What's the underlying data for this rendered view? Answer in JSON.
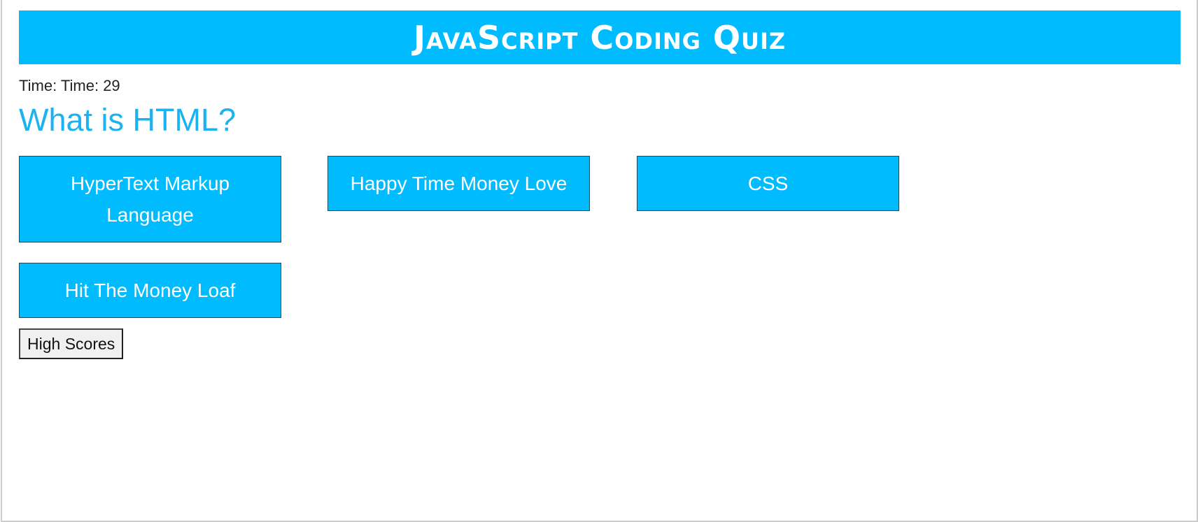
{
  "header": {
    "title": "JavaScript Coding Quiz"
  },
  "timer": {
    "text": "Time: Time: 29"
  },
  "question": {
    "text": "What is HTML?",
    "choices": [
      "HyperText Markup Language",
      "Happy Time Money Love",
      "CSS",
      "Hit The Money Loaf"
    ]
  },
  "controls": {
    "high_scores_label": "High Scores"
  },
  "colors": {
    "accent": "#00bcff",
    "question_text": "#1ab2f0"
  }
}
